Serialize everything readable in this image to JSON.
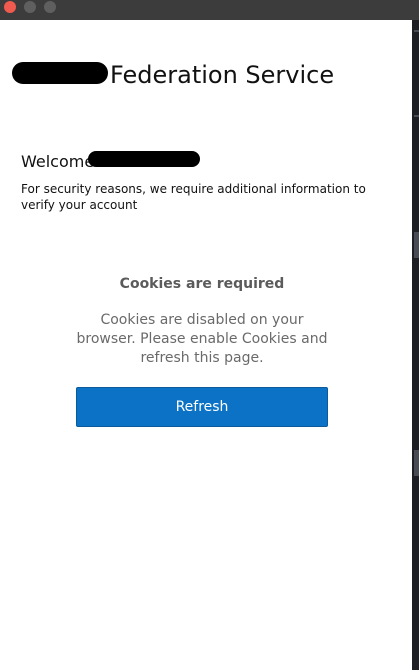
{
  "titlebar": {
    "buttons": [
      {
        "name": "close",
        "color": "#f05a4f"
      },
      {
        "name": "minimize",
        "color": "#5f5f5f"
      },
      {
        "name": "zoom",
        "color": "#5f5f5f"
      }
    ],
    "background": "#3c3c3c"
  },
  "header": {
    "title": "Federation Service"
  },
  "intro": {
    "welcome": "Welcome",
    "security_note": "For security reasons, we require additional information to verify your account"
  },
  "cookies": {
    "title": "Cookies are required",
    "message": "Cookies are disabled on your browser. Please enable Cookies and refresh this page."
  },
  "actions": {
    "refresh_label": "Refresh"
  },
  "colors": {
    "accent": "#0b72c5",
    "accent_border": "#0a5a9c",
    "muted_text": "#6a6a6a",
    "redaction": "#000000"
  }
}
